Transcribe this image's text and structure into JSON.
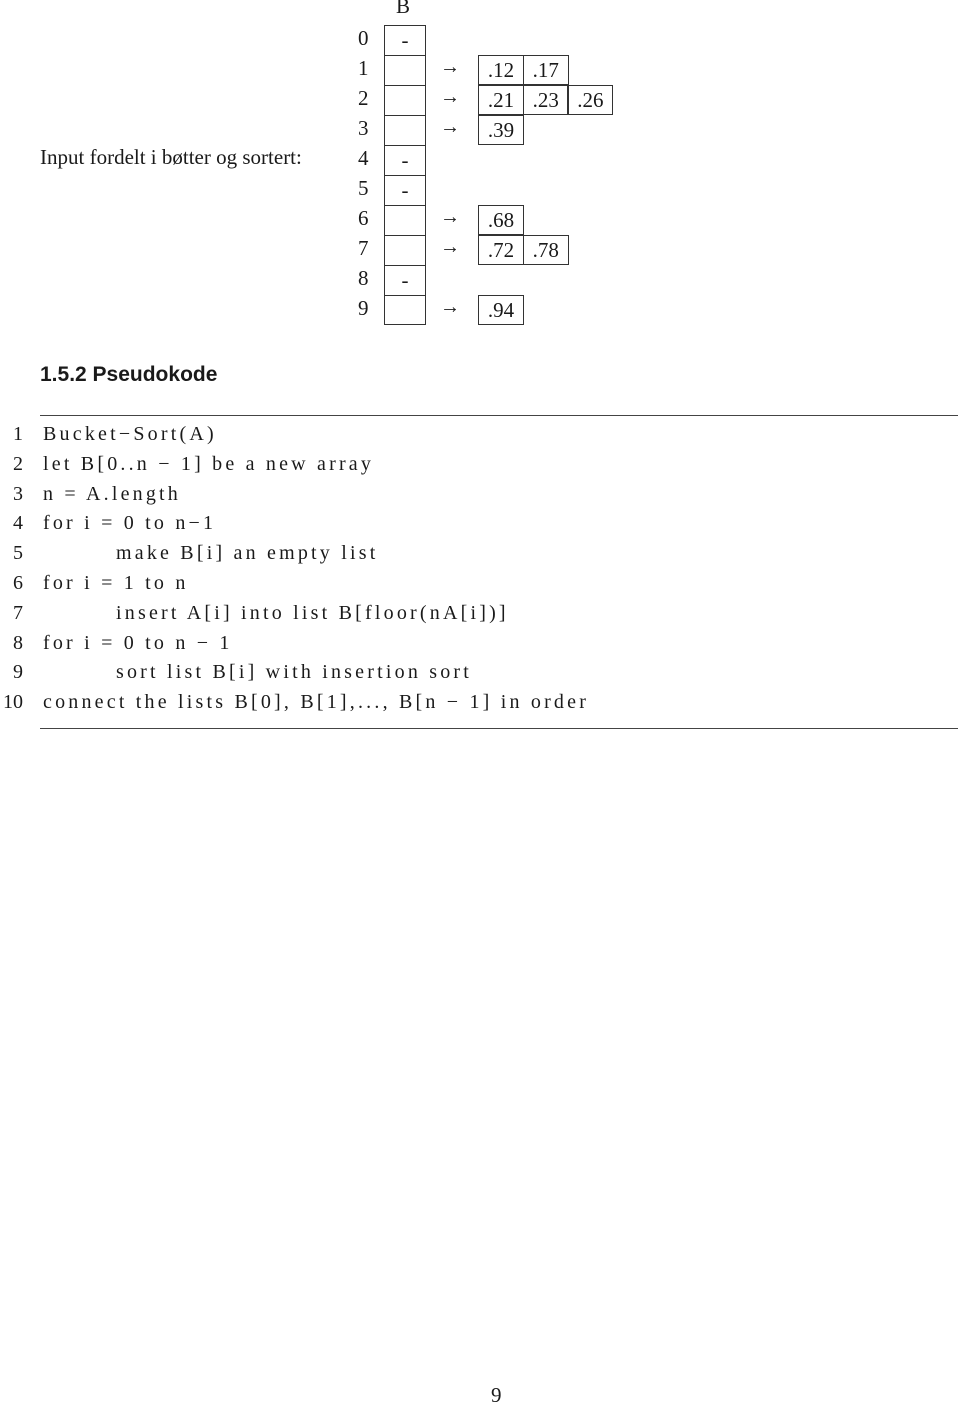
{
  "figure": {
    "array_label": "B",
    "caption": "Input fordelt i bøtter og sortert:",
    "arrow_icon": "→",
    "buckets": [
      {
        "index": "0",
        "slot": "-",
        "list": []
      },
      {
        "index": "1",
        "slot": "",
        "list": [
          ".12",
          ".17"
        ]
      },
      {
        "index": "2",
        "slot": "",
        "list": [
          ".21",
          ".23",
          ".26"
        ]
      },
      {
        "index": "3",
        "slot": "",
        "list": [
          ".39"
        ]
      },
      {
        "index": "4",
        "slot": "-",
        "list": []
      },
      {
        "index": "5",
        "slot": "-",
        "list": []
      },
      {
        "index": "6",
        "slot": "",
        "list": [
          ".68"
        ]
      },
      {
        "index": "7",
        "slot": "",
        "list": [
          ".72",
          ".78"
        ]
      },
      {
        "index": "8",
        "slot": "-",
        "list": []
      },
      {
        "index": "9",
        "slot": "",
        "list": [
          ".94"
        ]
      }
    ]
  },
  "section": {
    "title": "1.5.2 Pseudokode"
  },
  "pseudocode": [
    {
      "num": "1",
      "indent": false,
      "text": "Bucket−Sort(A)"
    },
    {
      "num": "2",
      "indent": false,
      "text": "let B[0..n − 1] be a new array"
    },
    {
      "num": "3",
      "indent": false,
      "text": "n = A.length"
    },
    {
      "num": "4",
      "indent": false,
      "text": "for i = 0 to n−1"
    },
    {
      "num": "5",
      "indent": true,
      "text": "make B[i] an empty list"
    },
    {
      "num": "6",
      "indent": false,
      "text": "for i = 1 to n"
    },
    {
      "num": "7",
      "indent": true,
      "text": "insert A[i] into list B[floor(nA[i])]"
    },
    {
      "num": "8",
      "indent": false,
      "text": "for i = 0 to n − 1"
    },
    {
      "num": "9",
      "indent": true,
      "text": "sort list B[i] with insertion sort"
    },
    {
      "num": "10",
      "indent": false,
      "text": "connect the lists B[0], B[1],..., B[n − 1] in order"
    }
  ],
  "page_number": "9"
}
